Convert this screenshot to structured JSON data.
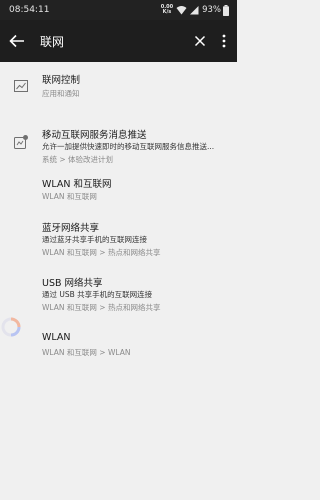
{
  "status_bar": {
    "time": "08:54:11",
    "net_speed_value": "0.00",
    "net_speed_unit": "K/s",
    "battery": "93%"
  },
  "search": {
    "query": "联网"
  },
  "results": [
    {
      "title": "联网控制",
      "subtitle": "应用和通知"
    },
    {
      "title": "移动互联网服务消息推送",
      "description": "允许一加提供快速即时的移动互联网服务信息推送...",
      "path": "系统 > 体验改进计划"
    },
    {
      "title": "WLAN 和互联网",
      "path": "WLAN 和互联网"
    },
    {
      "title": "蓝牙网络共享",
      "description": "通过蓝牙共享手机的互联网连接",
      "path": "WLAN 和互联网 > 热点和网络共享"
    },
    {
      "title": "USB 网络共享",
      "description": "通过 USB 共享手机的互联网连接",
      "path": "WLAN 和互联网 > 热点和网络共享"
    },
    {
      "title": "WLAN",
      "path": "WLAN 和互联网 > WLAN"
    }
  ],
  "colors": {
    "background": "#f0f0f0",
    "app_bar": "#1e1e1e",
    "status_bar": "#222222"
  }
}
